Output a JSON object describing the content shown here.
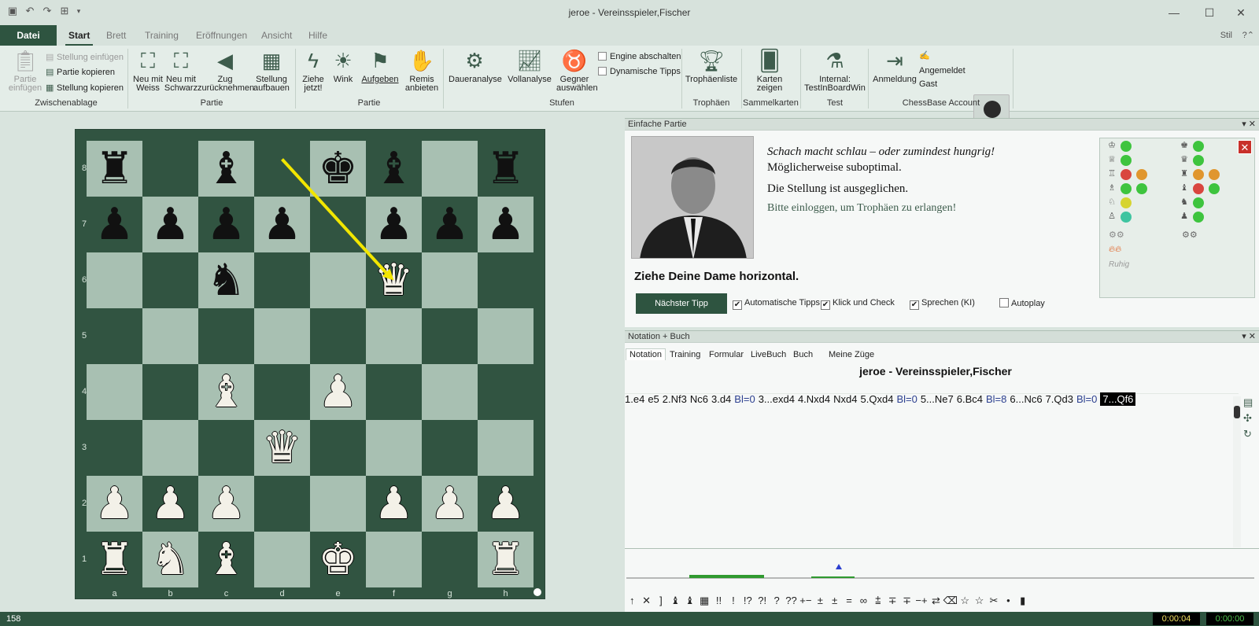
{
  "window": {
    "title": "jeroe - Vereinsspieler,Fischer"
  },
  "menu": {
    "file": "Datei",
    "tabs": [
      "Start",
      "Brett",
      "Training",
      "Eröffnungen",
      "Ansicht",
      "Hilfe"
    ],
    "active": "Start",
    "style": "Stil"
  },
  "ribbon": {
    "clipboard": {
      "paste_game": "Partie\neinfügen",
      "paste_position": "Stellung einfügen",
      "copy_game": "Partie kopieren",
      "copy_position": "Stellung kopieren",
      "group": "Zwischenablage"
    },
    "game1": {
      "new_white": "Neu mit\nWeiss",
      "new_black": "Neu mit\nSchwarz",
      "takeback": "Zug\nzurücknehmen",
      "setup": "Stellung\naufbauen",
      "group": "Partie"
    },
    "game2": {
      "move_now": "Ziehe\njetzt!",
      "hint": "Wink",
      "resign": "Aufgeben",
      "offer_draw": "Remis\nanbieten",
      "group": "Partie"
    },
    "levels": {
      "continuous": "Daueranalyse",
      "full": "Vollanalyse",
      "choose_opp": "Gegner\nauswählen",
      "engine_off": "Engine abschalten",
      "dynamic_tips": "Dynamische Tipps",
      "group": "Stufen"
    },
    "trophies": {
      "list": "Trophäenliste",
      "group": "Trophäen"
    },
    "cards": {
      "show": "Karten\nzeigen",
      "group": "Sammelkarten"
    },
    "test": {
      "internal": "Internal:\nTestInBoardWin",
      "group": "Test"
    },
    "account": {
      "login": "Anmeldung",
      "status": "Angemeldet",
      "user": "Gast",
      "group": "ChessBase Account"
    }
  },
  "board": {
    "ranks": [
      "8",
      "7",
      "6",
      "5",
      "4",
      "3",
      "2",
      "1"
    ],
    "files": [
      "a",
      "b",
      "c",
      "d",
      "e",
      "f",
      "g",
      "h"
    ],
    "pieces": [
      {
        "sq": "a8",
        "p": "r"
      },
      {
        "sq": "c8",
        "p": "b"
      },
      {
        "sq": "e8",
        "p": "k"
      },
      {
        "sq": "f8",
        "p": "b"
      },
      {
        "sq": "h8",
        "p": "r"
      },
      {
        "sq": "a7",
        "p": "p"
      },
      {
        "sq": "b7",
        "p": "p"
      },
      {
        "sq": "c7",
        "p": "p"
      },
      {
        "sq": "d7",
        "p": "p"
      },
      {
        "sq": "f7",
        "p": "p"
      },
      {
        "sq": "g7",
        "p": "p"
      },
      {
        "sq": "h7",
        "p": "p"
      },
      {
        "sq": "c6",
        "p": "n"
      },
      {
        "sq": "f6",
        "p": "Q"
      },
      {
        "sq": "c4",
        "p": "B"
      },
      {
        "sq": "e4",
        "p": "P"
      },
      {
        "sq": "d3",
        "p": "Q"
      },
      {
        "sq": "a2",
        "p": "P"
      },
      {
        "sq": "b2",
        "p": "P"
      },
      {
        "sq": "c2",
        "p": "P"
      },
      {
        "sq": "f2",
        "p": "P"
      },
      {
        "sq": "g2",
        "p": "P"
      },
      {
        "sq": "h2",
        "p": "P"
      },
      {
        "sq": "a1",
        "p": "R"
      },
      {
        "sq": "b1",
        "p": "N"
      },
      {
        "sq": "c1",
        "p": "B"
      },
      {
        "sq": "e1",
        "p": "K"
      },
      {
        "sq": "h1",
        "p": "R"
      }
    ],
    "arrow": {
      "from": "d8",
      "to": "f6",
      "color": "#f2e600"
    }
  },
  "coach": {
    "pane_title": "Einfache Partie",
    "line1": "Schach macht schlau – oder zumindest hungrig!",
    "line2": "Möglicherweise suboptimal.",
    "line3": "Die Stellung ist ausgeglichen.",
    "line4": "Bitte einloggen, um Trophäen zu erlangen!",
    "instruction": "Ziehe Deine Dame horizontal.",
    "next_tip": "Nächster Tipp",
    "checks": [
      {
        "label": "Automatische Tipps",
        "checked": true
      },
      {
        "label": "Klick und Check",
        "checked": true
      },
      {
        "label": "Sprechen (KI)",
        "checked": true
      },
      {
        "label": "Autoplay",
        "checked": false
      }
    ],
    "eval_status": "Ruhig",
    "eval_colors": {
      "green": "#3ec43e",
      "red": "#d9463f",
      "orange": "#e0962e",
      "yellow": "#d6d430",
      "teal": "#3ec4a0"
    }
  },
  "notation": {
    "pane_title": "Notation + Buch",
    "tabs": [
      "Notation",
      "Training",
      "Formular",
      "LiveBuch",
      "Buch",
      "Meine Züge"
    ],
    "header": "jeroe - Vereinsspieler,Fischer",
    "moves": [
      {
        "t": "1.e4"
      },
      {
        "t": "e5"
      },
      {
        "t": "2.Nf3"
      },
      {
        "t": "Nc6"
      },
      {
        "t": "3.d4"
      },
      {
        "t": "Bl=0",
        "c": "ev"
      },
      {
        "t": "3...exd4"
      },
      {
        "t": "4.Nxd4"
      },
      {
        "t": "Nxd4"
      },
      {
        "t": "5.Qxd4"
      },
      {
        "t": "Bl=0",
        "c": "ev"
      },
      {
        "t": "5...Ne7"
      },
      {
        "t": "6.Bc4"
      },
      {
        "t": "Bl=8",
        "c": "ev"
      },
      {
        "t": "6...Nc6"
      },
      {
        "t": "7.Qd3"
      },
      {
        "t": "Bl=0",
        "c": "ev"
      },
      {
        "t": "7...Qf6",
        "c": "cur"
      }
    ],
    "annotations": [
      "↑",
      "✕",
      "]",
      "♝",
      "♝",
      "▦",
      "!!",
      "!",
      "!?",
      "?!",
      "?",
      "??",
      "+−",
      "±",
      "±",
      "=",
      "∞",
      "⩲",
      "∓",
      "∓",
      "−+",
      "⇄",
      "⌫",
      "☆",
      "☆",
      "✂",
      "•",
      "▮"
    ]
  },
  "status": {
    "left": "158",
    "clock_white": "0:00:04",
    "clock_black": "0:00:00"
  }
}
